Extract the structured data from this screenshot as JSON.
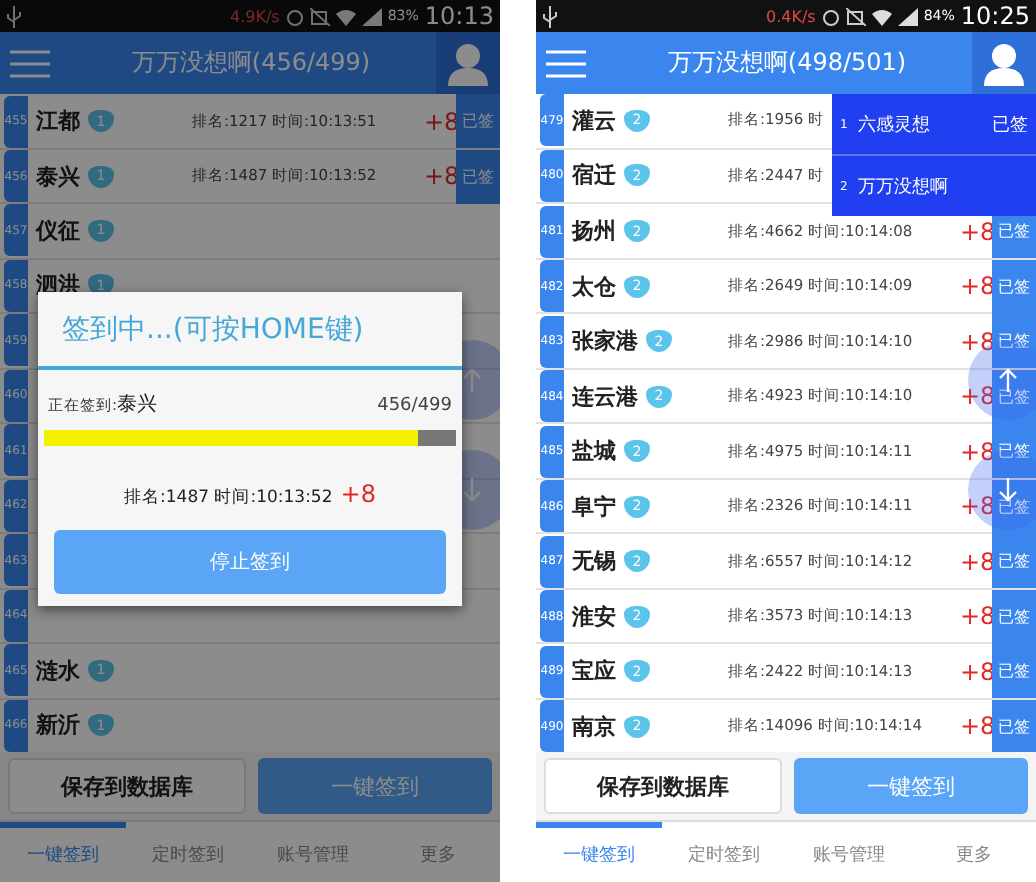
{
  "screens": [
    {
      "status_bar": {
        "speed": "4.9K/s",
        "battery": "83%",
        "time": "10:13"
      },
      "header": {
        "title": "万万没想啊(456/499)"
      },
      "rows": [
        {
          "number": "455",
          "name": "江都",
          "badge": "1",
          "info": "排名:1217 时间:10:13:51",
          "points": "+8",
          "tag": "已签"
        },
        {
          "number": "456",
          "name": "泰兴",
          "badge": "1",
          "info": "排名:1487 时间:10:13:52",
          "points": "+8",
          "tag": "已签"
        },
        {
          "number": "457",
          "name": "仪征",
          "badge": "1"
        },
        {
          "number": "458",
          "name": "泗洪",
          "badge": "1"
        },
        {
          "number": "459"
        },
        {
          "number": "460"
        },
        {
          "number": "461"
        },
        {
          "number": "462"
        },
        {
          "number": "463"
        },
        {
          "number": "464"
        },
        {
          "number": "465",
          "name": "涟水",
          "badge": "1"
        },
        {
          "number": "466",
          "name": "新沂",
          "badge": "1"
        }
      ],
      "actions": [
        {
          "label": "保存到数据库",
          "kind": "outline"
        },
        {
          "label": "一键签到",
          "kind": "primary"
        }
      ],
      "tabs": [
        {
          "label": "一键签到",
          "selected": true
        },
        {
          "label": "定时签到",
          "selected": false
        },
        {
          "label": "账号管理",
          "selected": false
        },
        {
          "label": "更多",
          "selected": false
        }
      ],
      "dialog": {
        "title": "签到中...(可按HOME键)",
        "label": "正在签到:",
        "current": "泰兴",
        "count": "456/499",
        "level": 0.91,
        "result": "排名:1487 时间:10:13:52",
        "points": "+8",
        "button": "停止签到"
      }
    },
    {
      "status_bar": {
        "speed": "0.4K/s",
        "battery": "84%",
        "time": "10:25"
      },
      "header": {
        "title": "万万没想啊(498/501)"
      },
      "rows": [
        {
          "number": "479",
          "name": "灌云",
          "badge": "2",
          "info": "排名:1956 时"
        },
        {
          "number": "480",
          "name": "宿迁",
          "badge": "2",
          "info": "排名:2447 时"
        },
        {
          "number": "481",
          "name": "扬州",
          "badge": "2",
          "info": "排名:4662 时间:10:14:08",
          "points": "+8",
          "tag": "已签"
        },
        {
          "number": "482",
          "name": "太仓",
          "badge": "2",
          "info": "排名:2649 时间:10:14:09",
          "points": "+8",
          "tag": "已签"
        },
        {
          "number": "483",
          "name": "张家港",
          "badge": "2",
          "info": "排名:2986 时间:10:14:10",
          "points": "+8",
          "tag": "已签"
        },
        {
          "number": "484",
          "name": "连云港",
          "badge": "2",
          "info": "排名:4923 时间:10:14:10",
          "points": "+8",
          "tag": "已签"
        },
        {
          "number": "485",
          "name": "盐城",
          "badge": "2",
          "info": "排名:4975 时间:10:14:11",
          "points": "+8",
          "tag": "已签"
        },
        {
          "number": "486",
          "name": "阜宁",
          "badge": "2",
          "info": "排名:2326 时间:10:14:11",
          "points": "+8",
          "tag": "已签"
        },
        {
          "number": "487",
          "name": "无锡",
          "badge": "2",
          "info": "排名:6557 时间:10:14:12",
          "points": "+8",
          "tag": "已签"
        },
        {
          "number": "488",
          "name": "淮安",
          "badge": "2",
          "info": "排名:3573 时间:10:14:13",
          "points": "+8",
          "tag": "已签"
        },
        {
          "number": "489",
          "name": "宝应",
          "badge": "2",
          "info": "排名:2422 时间:10:14:13",
          "points": "+8",
          "tag": "已签"
        },
        {
          "number": "490",
          "name": "南京",
          "badge": "2",
          "info": "排名:14096 时间:10:14:14",
          "points": "+8",
          "tag": "已签"
        }
      ],
      "actions": [
        {
          "label": "保存到数据库",
          "kind": "outline"
        },
        {
          "label": "一键签到",
          "kind": "primary"
        }
      ],
      "tabs": [
        {
          "label": "一键签到",
          "selected": true
        },
        {
          "label": "定时签到",
          "selected": false
        },
        {
          "label": "账号管理",
          "selected": false
        },
        {
          "label": "更多",
          "selected": false
        }
      ],
      "menu": [
        {
          "index": "1",
          "name": "六感灵想",
          "tag": "已签"
        },
        {
          "index": "2",
          "name": "万万没想啊"
        }
      ]
    }
  ]
}
